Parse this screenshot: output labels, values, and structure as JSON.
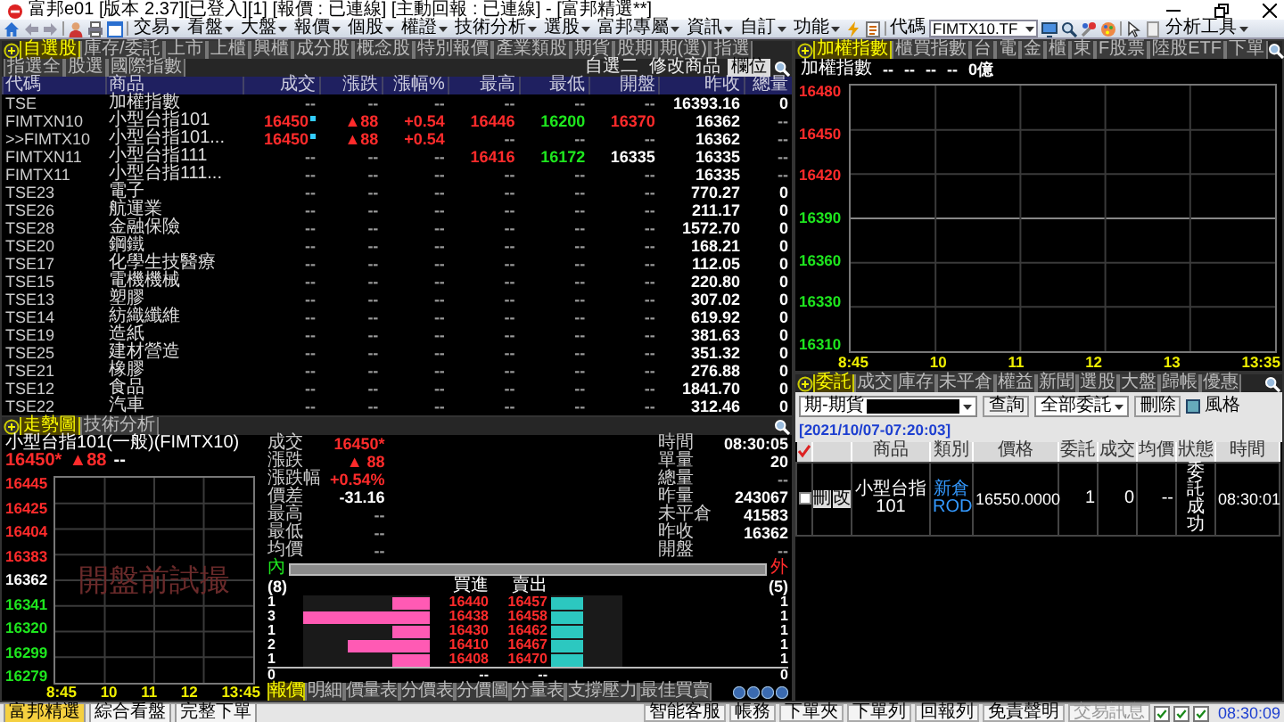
{
  "window": {
    "title": "富邦e01 [版本 2.37][已登入][1] [報價 : 已連線] [主動回報 : 已連線] - [富邦精選**]"
  },
  "toolbar": {
    "menus": [
      "交易",
      "看盤",
      "大盤",
      "報價",
      "個股",
      "權證",
      "技術分析",
      "選股",
      "富邦專屬",
      "資訊",
      "自訂",
      "功能"
    ],
    "code_label": "代碼",
    "code_value": "FIMTX10.TF",
    "tools_menu": "分析工具"
  },
  "watchlist": {
    "tabs": [
      {
        "label": "自選股",
        "selected": true
      },
      {
        "label": "庫存/委託",
        "selected": false
      },
      {
        "label": "上市",
        "selected": false
      },
      {
        "label": "上櫃",
        "selected": false
      },
      {
        "label": "興櫃",
        "selected": false
      },
      {
        "label": "成分股",
        "selected": false
      },
      {
        "label": "概念股",
        "selected": false
      },
      {
        "label": "特別報價",
        "selected": false
      },
      {
        "label": "產業類股",
        "selected": false
      },
      {
        "label": "期貨",
        "selected": false
      },
      {
        "label": "股期",
        "selected": false
      },
      {
        "label": "期(選)",
        "selected": false
      },
      {
        "label": "指選",
        "selected": false
      },
      {
        "label": "指選全",
        "selected": false
      },
      {
        "label": "股選",
        "selected": false
      },
      {
        "label": "國際指數",
        "selected": false
      }
    ],
    "list_name": "自選二",
    "buttons": [
      "修改商品",
      "欄位"
    ],
    "columns": [
      "代碼",
      "商品",
      "成交",
      "漲跌",
      "漲幅%",
      "最高",
      "最低",
      "開盤",
      "昨收",
      "總量"
    ],
    "rows": [
      {
        "cells": [
          {
            "text": "TSE"
          },
          {
            "text": "加權指數"
          },
          {
            "text": "--"
          },
          {
            "text": "--"
          },
          {
            "text": "--"
          },
          {
            "text": "--"
          },
          {
            "text": "--"
          },
          {
            "text": "--"
          },
          {
            "text": "16393.16",
            "color": "#ffffff"
          },
          {
            "text": "0",
            "color": "#ffffff"
          }
        ]
      },
      {
        "cells": [
          {
            "text": "FIMTXN10"
          },
          {
            "text": "小型台指101"
          },
          {
            "text": "16450",
            "color": "#ff2b2b",
            "flag": true
          },
          {
            "text": "▲88",
            "color": "#ff2b2b"
          },
          {
            "text": "+0.54",
            "color": "#ff2b2b"
          },
          {
            "text": "16446",
            "color": "#ff2b2b"
          },
          {
            "text": "16200",
            "color": "#1ee61e"
          },
          {
            "text": "16370",
            "color": "#ff2b2b"
          },
          {
            "text": "16362",
            "color": "#ffffff"
          },
          {
            "text": "--"
          }
        ]
      },
      {
        "cells": [
          {
            "text": ">>FIMTX10"
          },
          {
            "text": "小型台指101..."
          },
          {
            "text": "16450",
            "color": "#ff2b2b",
            "flag": true
          },
          {
            "text": "▲88",
            "color": "#ff2b2b"
          },
          {
            "text": "+0.54",
            "color": "#ff2b2b"
          },
          {
            "text": "--"
          },
          {
            "text": "--"
          },
          {
            "text": "--"
          },
          {
            "text": "16362",
            "color": "#ffffff"
          },
          {
            "text": "--"
          }
        ]
      },
      {
        "cells": [
          {
            "text": "FIMTXN11"
          },
          {
            "text": "小型台指111"
          },
          {
            "text": "--"
          },
          {
            "text": "--"
          },
          {
            "text": "--"
          },
          {
            "text": "16416",
            "color": "#ff2b2b"
          },
          {
            "text": "16172",
            "color": "#1ee61e"
          },
          {
            "text": "16335",
            "color": "#ffffff"
          },
          {
            "text": "16335",
            "color": "#ffffff"
          },
          {
            "text": "--"
          }
        ]
      },
      {
        "cells": [
          {
            "text": "FIMTX11"
          },
          {
            "text": "小型台指111..."
          },
          {
            "text": "--"
          },
          {
            "text": "--"
          },
          {
            "text": "--"
          },
          {
            "text": "--"
          },
          {
            "text": "--"
          },
          {
            "text": "--"
          },
          {
            "text": "16335",
            "color": "#ffffff"
          },
          {
            "text": "--"
          }
        ]
      },
      {
        "cells": [
          {
            "text": "TSE23"
          },
          {
            "text": "電子"
          },
          {
            "text": "--"
          },
          {
            "text": "--"
          },
          {
            "text": "--"
          },
          {
            "text": "--"
          },
          {
            "text": "--"
          },
          {
            "text": "--"
          },
          {
            "text": "770.27",
            "color": "#ffffff"
          },
          {
            "text": "0",
            "color": "#ffffff"
          }
        ]
      },
      {
        "cells": [
          {
            "text": "TSE26"
          },
          {
            "text": "航運業"
          },
          {
            "text": "--"
          },
          {
            "text": "--"
          },
          {
            "text": "--"
          },
          {
            "text": "--"
          },
          {
            "text": "--"
          },
          {
            "text": "--"
          },
          {
            "text": "211.17",
            "color": "#ffffff"
          },
          {
            "text": "0",
            "color": "#ffffff"
          }
        ]
      },
      {
        "cells": [
          {
            "text": "TSE28"
          },
          {
            "text": "金融保險"
          },
          {
            "text": "--"
          },
          {
            "text": "--"
          },
          {
            "text": "--"
          },
          {
            "text": "--"
          },
          {
            "text": "--"
          },
          {
            "text": "--"
          },
          {
            "text": "1572.70",
            "color": "#ffffff"
          },
          {
            "text": "0",
            "color": "#ffffff"
          }
        ]
      },
      {
        "cells": [
          {
            "text": "TSE20"
          },
          {
            "text": "鋼鐵"
          },
          {
            "text": "--"
          },
          {
            "text": "--"
          },
          {
            "text": "--"
          },
          {
            "text": "--"
          },
          {
            "text": "--"
          },
          {
            "text": "--"
          },
          {
            "text": "168.21",
            "color": "#ffffff"
          },
          {
            "text": "0",
            "color": "#ffffff"
          }
        ]
      },
      {
        "cells": [
          {
            "text": "TSE17"
          },
          {
            "text": "化學生技醫療"
          },
          {
            "text": "--"
          },
          {
            "text": "--"
          },
          {
            "text": "--"
          },
          {
            "text": "--"
          },
          {
            "text": "--"
          },
          {
            "text": "--"
          },
          {
            "text": "112.05",
            "color": "#ffffff"
          },
          {
            "text": "0",
            "color": "#ffffff"
          }
        ]
      },
      {
        "cells": [
          {
            "text": "TSE15"
          },
          {
            "text": "電機機械"
          },
          {
            "text": "--"
          },
          {
            "text": "--"
          },
          {
            "text": "--"
          },
          {
            "text": "--"
          },
          {
            "text": "--"
          },
          {
            "text": "--"
          },
          {
            "text": "220.80",
            "color": "#ffffff"
          },
          {
            "text": "0",
            "color": "#ffffff"
          }
        ]
      },
      {
        "cells": [
          {
            "text": "TSE13"
          },
          {
            "text": "塑膠"
          },
          {
            "text": "--"
          },
          {
            "text": "--"
          },
          {
            "text": "--"
          },
          {
            "text": "--"
          },
          {
            "text": "--"
          },
          {
            "text": "--"
          },
          {
            "text": "307.02",
            "color": "#ffffff"
          },
          {
            "text": "0",
            "color": "#ffffff"
          }
        ]
      },
      {
        "cells": [
          {
            "text": "TSE14"
          },
          {
            "text": "紡織纖維"
          },
          {
            "text": "--"
          },
          {
            "text": "--"
          },
          {
            "text": "--"
          },
          {
            "text": "--"
          },
          {
            "text": "--"
          },
          {
            "text": "--"
          },
          {
            "text": "619.92",
            "color": "#ffffff"
          },
          {
            "text": "0",
            "color": "#ffffff"
          }
        ]
      },
      {
        "cells": [
          {
            "text": "TSE19"
          },
          {
            "text": "造紙"
          },
          {
            "text": "--"
          },
          {
            "text": "--"
          },
          {
            "text": "--"
          },
          {
            "text": "--"
          },
          {
            "text": "--"
          },
          {
            "text": "--"
          },
          {
            "text": "381.63",
            "color": "#ffffff"
          },
          {
            "text": "0",
            "color": "#ffffff"
          }
        ]
      },
      {
        "cells": [
          {
            "text": "TSE25"
          },
          {
            "text": "建材營造"
          },
          {
            "text": "--"
          },
          {
            "text": "--"
          },
          {
            "text": "--"
          },
          {
            "text": "--"
          },
          {
            "text": "--"
          },
          {
            "text": "--"
          },
          {
            "text": "351.32",
            "color": "#ffffff"
          },
          {
            "text": "0",
            "color": "#ffffff"
          }
        ]
      },
      {
        "cells": [
          {
            "text": "TSE21"
          },
          {
            "text": "橡膠"
          },
          {
            "text": "--"
          },
          {
            "text": "--"
          },
          {
            "text": "--"
          },
          {
            "text": "--"
          },
          {
            "text": "--"
          },
          {
            "text": "--"
          },
          {
            "text": "276.88",
            "color": "#ffffff"
          },
          {
            "text": "0",
            "color": "#ffffff"
          }
        ]
      },
      {
        "cells": [
          {
            "text": "TSE12"
          },
          {
            "text": "食品"
          },
          {
            "text": "--"
          },
          {
            "text": "--"
          },
          {
            "text": "--"
          },
          {
            "text": "--"
          },
          {
            "text": "--"
          },
          {
            "text": "--"
          },
          {
            "text": "1841.70",
            "color": "#ffffff"
          },
          {
            "text": "0",
            "color": "#ffffff"
          }
        ]
      },
      {
        "cells": [
          {
            "text": "TSE22"
          },
          {
            "text": "汽車"
          },
          {
            "text": "--"
          },
          {
            "text": "--"
          },
          {
            "text": "--"
          },
          {
            "text": "--"
          },
          {
            "text": "--"
          },
          {
            "text": "--"
          },
          {
            "text": "312.46",
            "color": "#ffffff"
          },
          {
            "text": "0",
            "color": "#ffffff"
          }
        ]
      }
    ]
  },
  "quote": {
    "tabs": [
      {
        "label": "走勢圖",
        "selected": true
      },
      {
        "label": "技術分析",
        "selected": false
      }
    ],
    "instrument": "小型台指101(一般)(FIMTX10)",
    "last": {
      "text": "16450*",
      "color": "#ff2b2b"
    },
    "change": {
      "text": "▲88",
      "color": "#ff2b2b"
    },
    "extra": "--",
    "y_axis": [
      {
        "text": "16445",
        "color": "#ff2b2b"
      },
      {
        "text": "16425",
        "color": "#ff2b2b"
      },
      {
        "text": "16404",
        "color": "#ff2b2b"
      },
      {
        "text": "16383",
        "color": "#ff2b2b"
      },
      {
        "text": "16362",
        "color": "#ffffff"
      },
      {
        "text": "16341",
        "color": "#1ee61e"
      },
      {
        "text": "16320",
        "color": "#1ee61e"
      },
      {
        "text": "16299",
        "color": "#1ee61e"
      },
      {
        "text": "16279",
        "color": "#1ee61e"
      }
    ],
    "x_axis": [
      "8:45",
      "10",
      "11",
      "12",
      "13:45"
    ],
    "watermark": "開盤前試撮",
    "stats": [
      {
        "label": "成交",
        "value": "16450*",
        "color": "#ff2b2b"
      },
      {
        "label": "時間",
        "value": "08:30:05",
        "color": "#ffffff"
      },
      {
        "label": "漲跌",
        "value": "▲ 88",
        "color": "#ff2b2b"
      },
      {
        "label": "單量",
        "value": "20",
        "color": "#ffffff"
      },
      {
        "label": "漲跌幅",
        "value": "+0.54%",
        "color": "#ff2b2b"
      },
      {
        "label": "總量",
        "value": "--",
        "color": "#9a9a9a"
      },
      {
        "label": "價差",
        "value": "-31.16",
        "color": "#ffffff"
      },
      {
        "label": "昨量",
        "value": "243067",
        "color": "#ffffff"
      },
      {
        "label": "最高",
        "value": "--",
        "color": "#9a9a9a"
      },
      {
        "label": "未平倉",
        "value": "41583",
        "color": "#ffffff"
      },
      {
        "label": "最低",
        "value": "--",
        "color": "#9a9a9a"
      },
      {
        "label": "昨收",
        "value": "16362",
        "color": "#ffffff"
      },
      {
        "label": "均價",
        "value": "--",
        "color": "#9a9a9a"
      },
      {
        "label": "開盤",
        "value": "--",
        "color": "#9a9a9a"
      }
    ],
    "ratio": {
      "inner": "內",
      "outer": "外"
    },
    "ladder": {
      "bid_count": "(8)",
      "bid_header": "買進",
      "ask_header": "賣出",
      "ask_count": "(5)",
      "levels": [
        {
          "bid_qty": "1",
          "bid_bar": {
            "level": 0.3
          },
          "bid": "16440",
          "ask": "16457",
          "ask_bar": {
            "level": 0.45
          },
          "ask_qty": "1"
        },
        {
          "bid_qty": "3",
          "bid_bar": {
            "level": 1
          },
          "bid": "16438",
          "ask": "16458",
          "ask_bar": {
            "level": 0.45
          },
          "ask_qty": "1"
        },
        {
          "bid_qty": "1",
          "bid_bar": {
            "level": 0.3
          },
          "bid": "16430",
          "ask": "16462",
          "ask_bar": {
            "level": 0.45
          },
          "ask_qty": "1"
        },
        {
          "bid_qty": "2",
          "bid_bar": {
            "level": 0.65
          },
          "bid": "16410",
          "ask": "16467",
          "ask_bar": {
            "level": 0.45
          },
          "ask_qty": "1"
        },
        {
          "bid_qty": "1",
          "bid_bar": {
            "level": 0.3
          },
          "bid": "16408",
          "ask": "16470",
          "ask_bar": {
            "level": 0.45
          },
          "ask_qty": "1"
        }
      ],
      "totals": {
        "bid_qty": "0",
        "bid": "--",
        "ask": "--",
        "ask_qty": "0"
      }
    },
    "bottom_tabs": [
      {
        "label": "報價",
        "selected": true
      },
      {
        "label": "明細",
        "selected": false
      },
      {
        "label": "價量表",
        "selected": false
      },
      {
        "label": "分價表",
        "selected": false
      },
      {
        "label": "分價圖",
        "selected": false
      },
      {
        "label": "分量表",
        "selected": false
      },
      {
        "label": "支撐壓力",
        "selected": false
      },
      {
        "label": "最佳買賣",
        "selected": false
      }
    ]
  },
  "index_chart": {
    "tabs": [
      {
        "label": "加權指數",
        "selected": true
      },
      {
        "label": "櫃買指數",
        "selected": false
      },
      {
        "label": "台",
        "selected": false
      },
      {
        "label": "電",
        "selected": false
      },
      {
        "label": "金",
        "selected": false
      },
      {
        "label": "櫃",
        "selected": false
      },
      {
        "label": "東",
        "selected": false
      },
      {
        "label": "F股票",
        "selected": false
      },
      {
        "label": "陸股ETF",
        "selected": false
      },
      {
        "label": "下單",
        "selected": false
      }
    ],
    "name": "加權指數",
    "quote": [
      "--",
      "--",
      "--",
      "--",
      "0億"
    ],
    "y_axis": [
      {
        "text": "16480",
        "color": "#ff2b2b"
      },
      {
        "text": "16450",
        "color": "#ff2b2b"
      },
      {
        "text": "16420",
        "color": "#ff2b2b"
      },
      {
        "text": "16390",
        "color": "#1ee61e"
      },
      {
        "text": "16360",
        "color": "#1ee61e"
      },
      {
        "text": "16330",
        "color": "#1ee61e"
      },
      {
        "text": "16310",
        "color": "#1ee61e"
      }
    ],
    "x_axis": [
      "8:45",
      "10",
      "11",
      "12",
      "13",
      "13:35"
    ]
  },
  "orders": {
    "tabs": [
      {
        "label": "委託",
        "selected": true
      },
      {
        "label": "成交",
        "selected": false
      },
      {
        "label": "庫存",
        "selected": false
      },
      {
        "label": "未平倉",
        "selected": false
      },
      {
        "label": "權益",
        "selected": false
      },
      {
        "label": "新聞",
        "selected": false
      },
      {
        "label": "選股",
        "selected": false
      },
      {
        "label": "大盤",
        "selected": false
      },
      {
        "label": "歸帳",
        "selected": false
      },
      {
        "label": "優惠",
        "selected": false
      }
    ],
    "account": "期-期貨",
    "query_button": "查詢",
    "filter": "全部委託",
    "delete_button": "刪除",
    "style_button": "風格",
    "timestamp": "[2021/10/07-07:20:03]",
    "columns": [
      "商品",
      "類別",
      "價格",
      "委託",
      "成交",
      "均價",
      "狀態",
      "時間"
    ],
    "rows": [
      {
        "checked": false,
        "actions": [
          "刪",
          "改"
        ],
        "cells": [
          "小型台指101",
          "新倉ROD",
          "16550.0000",
          "1",
          "0",
          "--",
          "委託成功",
          "08:30:01"
        ]
      }
    ]
  },
  "status_bar": {
    "tabs": [
      {
        "label": "富邦精選",
        "selected": true
      },
      {
        "label": "綜合看盤",
        "selected": false
      },
      {
        "label": "完整下單",
        "selected": false
      }
    ],
    "buttons": [
      {
        "label": "智能客服",
        "disabled": false
      },
      {
        "label": "帳務",
        "disabled": false
      },
      {
        "label": "下單夾",
        "disabled": false
      },
      {
        "label": "下單列",
        "disabled": false
      },
      {
        "label": "回報列",
        "disabled": false
      },
      {
        "label": "免責聲明",
        "disabled": false
      },
      {
        "label": "交易訊息",
        "disabled": true
      }
    ],
    "checkboxes": [
      {
        "checked": true
      },
      {
        "checked": true
      },
      {
        "checked": true
      }
    ],
    "time": "08:30:09"
  }
}
